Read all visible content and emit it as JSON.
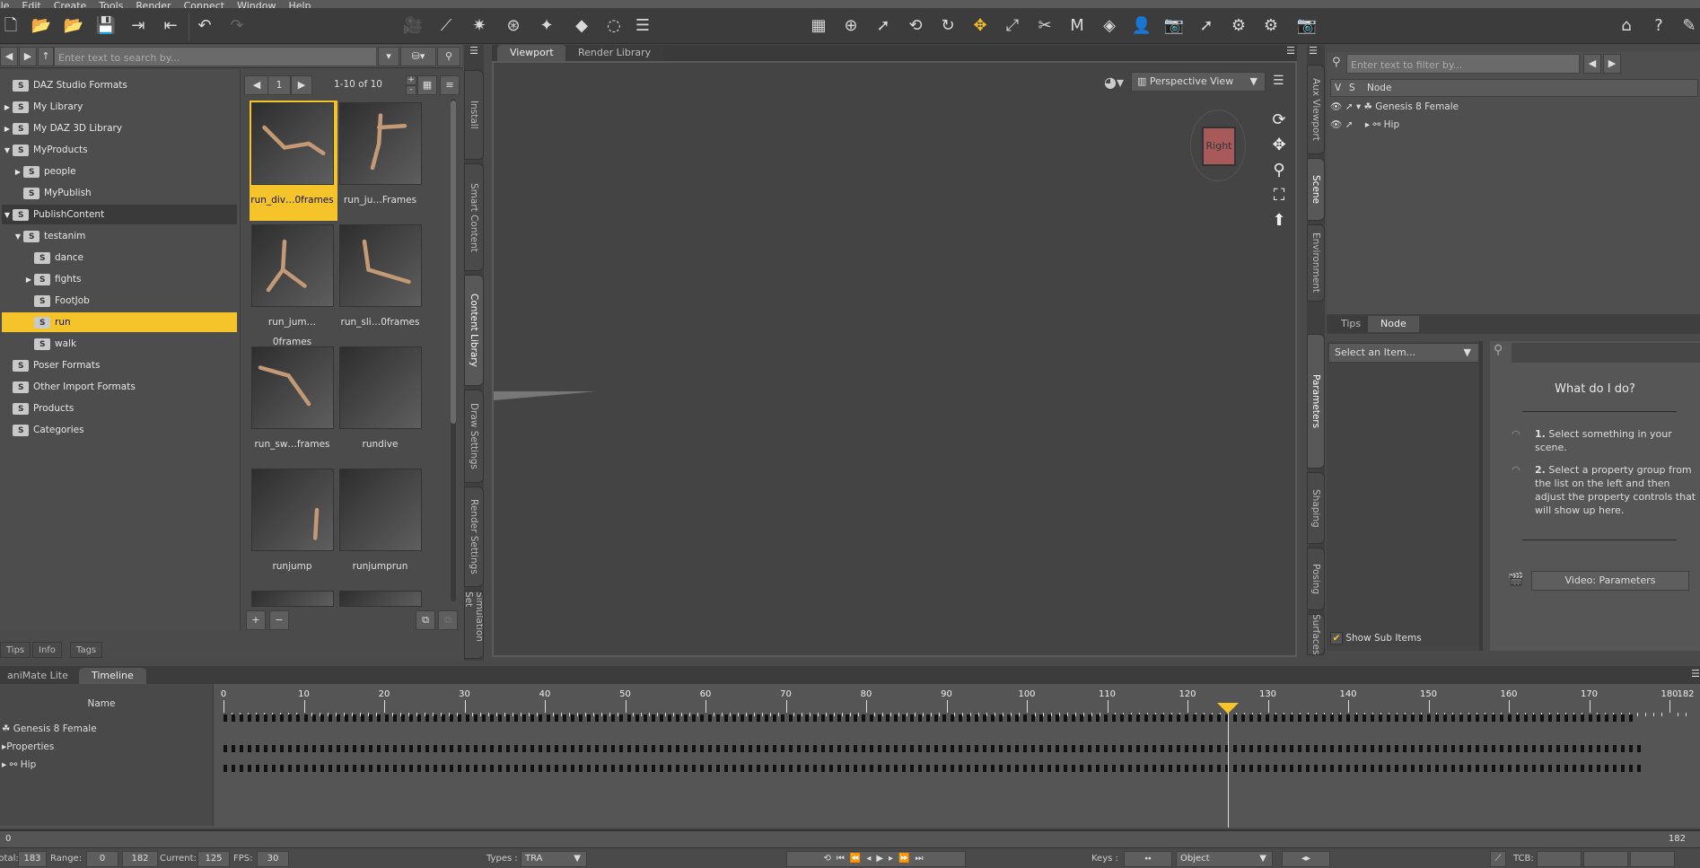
{
  "menu": [
    "File",
    "Edit",
    "Create",
    "Tools",
    "Render",
    "Connect",
    "Window",
    "Help"
  ],
  "content_library": {
    "search_placeholder": "Enter text to search by...",
    "tree": [
      {
        "label": "DAZ Studio Formats",
        "depth": 0,
        "arrow": ""
      },
      {
        "label": "My Library",
        "depth": 0,
        "arrow": "▶"
      },
      {
        "label": "My DAZ 3D Library",
        "depth": 0,
        "arrow": "▶"
      },
      {
        "label": "MyProducts",
        "depth": 0,
        "arrow": "▼"
      },
      {
        "label": "people",
        "depth": 1,
        "arrow": "▶"
      },
      {
        "label": "MyPublish",
        "depth": 1,
        "arrow": ""
      },
      {
        "label": "PublishContent",
        "depth": 0,
        "arrow": "▼"
      },
      {
        "label": "testanim",
        "depth": 1,
        "arrow": "▼"
      },
      {
        "label": "dance",
        "depth": 2,
        "arrow": ""
      },
      {
        "label": "fights",
        "depth": 2,
        "arrow": "▶"
      },
      {
        "label": "FootJob",
        "depth": 2,
        "arrow": ""
      },
      {
        "label": "run",
        "depth": 2,
        "arrow": ""
      },
      {
        "label": "walk",
        "depth": 2,
        "arrow": ""
      },
      {
        "label": "Poser Formats",
        "depth": 0,
        "arrow": ""
      },
      {
        "label": "Other Import Formats",
        "depth": 0,
        "arrow": ""
      },
      {
        "label": "Products",
        "depth": 0,
        "arrow": ""
      },
      {
        "label": "Categories",
        "depth": 0,
        "arrow": ""
      }
    ],
    "selected_folder": "run",
    "page": "1",
    "range": "1-10 of 10",
    "items": [
      "run_div…0frames",
      "run_ju…Frames",
      "run_jum…0frames",
      "run_sli…0frames",
      "run_sw…frames",
      "rundive",
      "runjump",
      "runjumprun"
    ],
    "bottom_tabs": [
      "Tips",
      "Info",
      "Tags"
    ],
    "side_tabs": [
      "Install",
      "Smart Content",
      "Content Library",
      "Draw Settings",
      "Render Settings",
      "Simulation Set"
    ]
  },
  "viewport": {
    "tabs": [
      "Viewport",
      "Render Library"
    ],
    "view_select": "Perspective View",
    "cube_label": "Right"
  },
  "scene": {
    "side_tabs": [
      "Aux Viewport",
      "Scene",
      "Environment"
    ],
    "filter_placeholder": "Enter text to filter by...",
    "columns": [
      "V",
      "S",
      "Node"
    ],
    "nodes": [
      {
        "label": "Genesis 8 Female"
      },
      {
        "label": "Hip"
      }
    ],
    "lower_tabs": [
      "Tips",
      "Node"
    ]
  },
  "parameters": {
    "side_tabs": [
      "Parameters",
      "Shaping",
      "Posing",
      "Surfaces"
    ],
    "select_label": "Select an Item...",
    "show_sub_items": "Show Sub Items",
    "help_title": "What do I do?",
    "step1_num": "1.",
    "step1": "Select something in your scene.",
    "step2_num": "2.",
    "step2": "Select a property group from the list on the left and then adjust the property controls that will show up here.",
    "video_button": "Video: Parameters"
  },
  "timeline": {
    "tabs": [
      "aniMate Lite",
      "Timeline"
    ],
    "name_header": "Name",
    "rows": [
      "Genesis 8 Female",
      "Properties",
      "Hip"
    ],
    "ticks": [
      0,
      10,
      20,
      30,
      40,
      50,
      60,
      70,
      80,
      90,
      100,
      110,
      120,
      130,
      140,
      150,
      160,
      170,
      180
    ],
    "end_label": "182",
    "current_frame": 125,
    "max_frame": 180,
    "scrub_start": "0",
    "scrub_end": "182"
  },
  "status": {
    "total_label": "Total:",
    "total": "183",
    "range_label": "Range:",
    "range_start": "0",
    "range_end": "182",
    "current_label": "Current:",
    "current": "125",
    "fps_label": "FPS:",
    "fps": "30",
    "types_label": "Types :",
    "types": "TRA",
    "keys_label": "Keys :",
    "keys_mode": "Object",
    "tcb_label": "TCB:"
  },
  "colors": {
    "accent": "#f5c42b",
    "panel": "#4b4b4b",
    "toolbar": "#3c3c3c"
  }
}
